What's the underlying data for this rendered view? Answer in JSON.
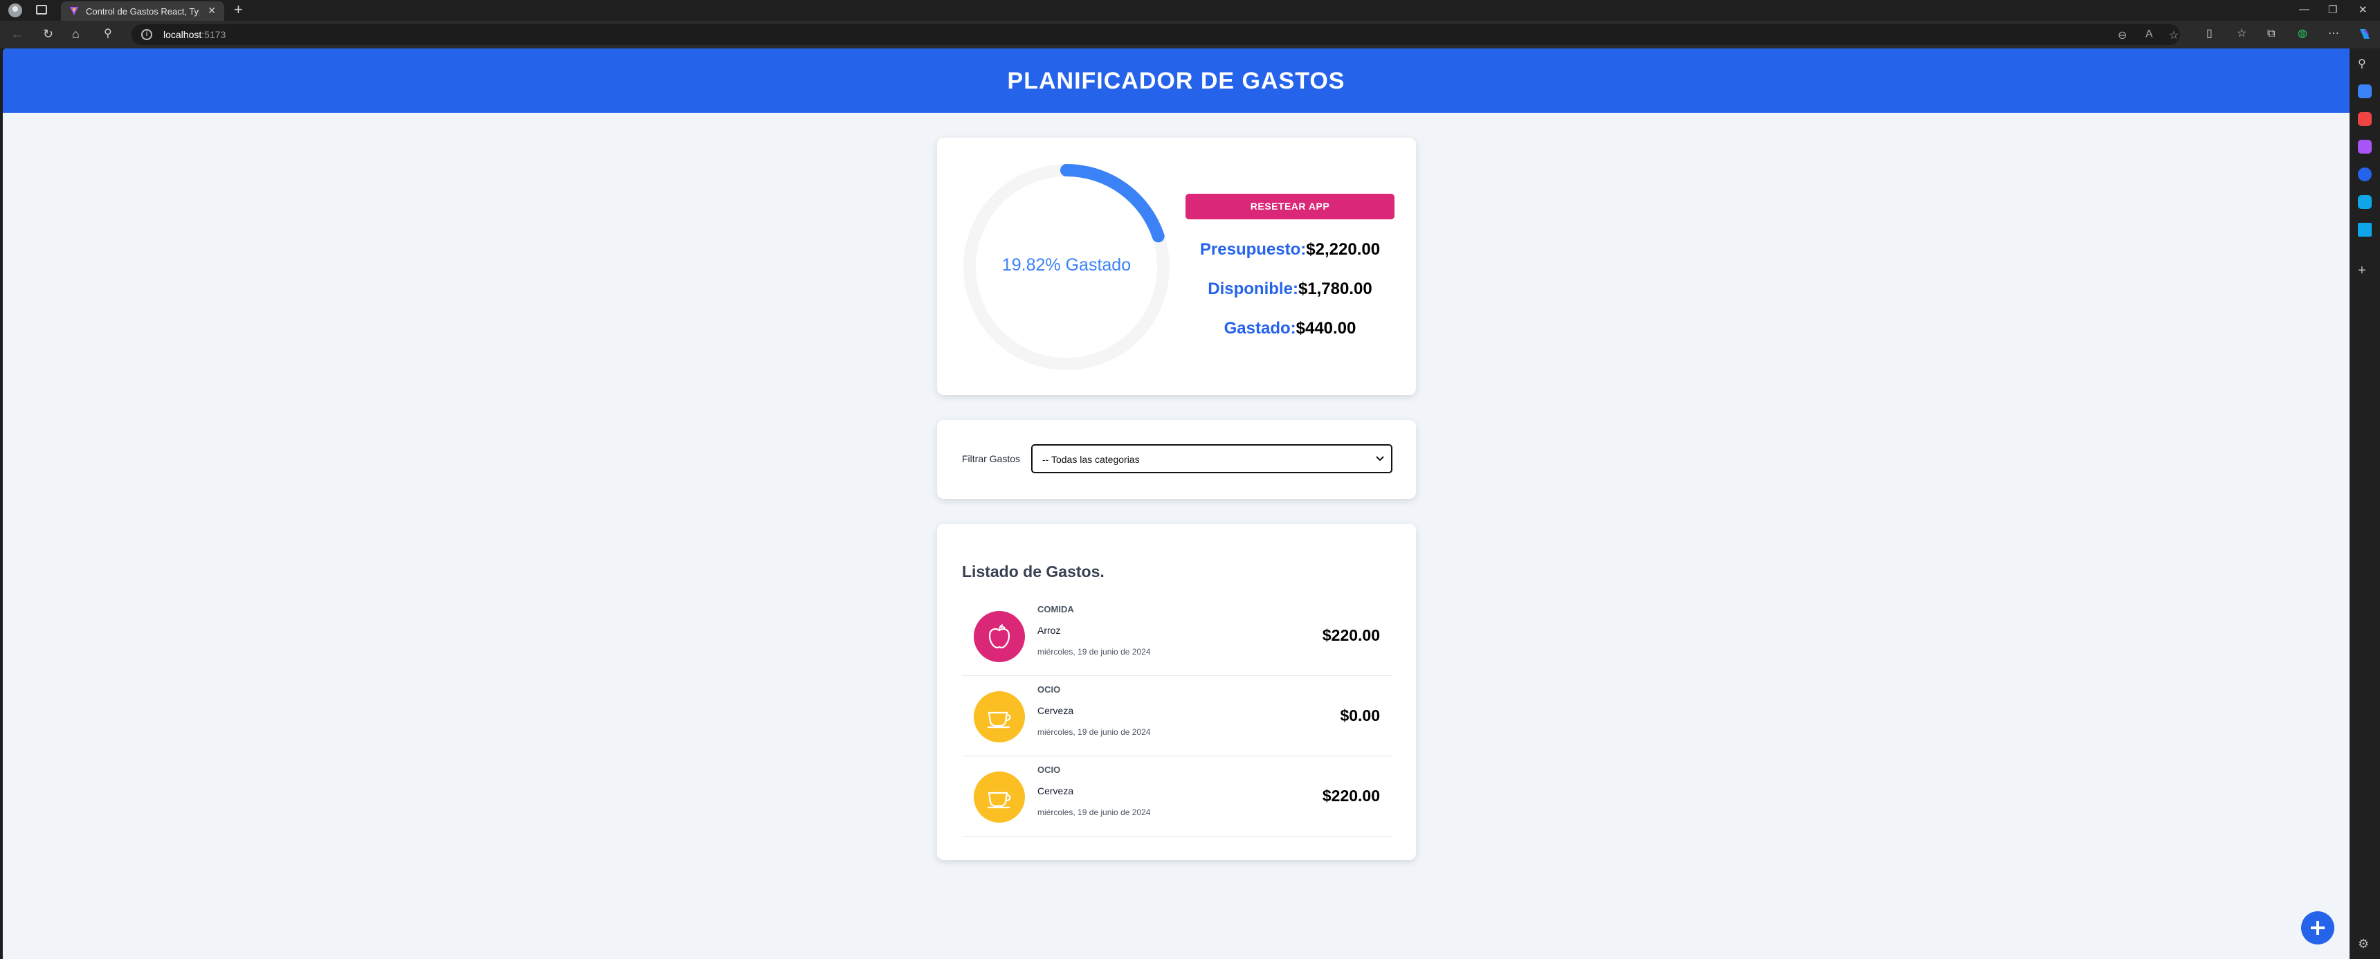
{
  "browser": {
    "tab_title": "Control de Gastos React, TypeScript",
    "tab_close": "✕",
    "new_tab": "+",
    "address_host": "localhost",
    "address_port": ":5173"
  },
  "header": {
    "title": "PLANIFICADOR DE GASTOS"
  },
  "budget": {
    "percent_label": "19.82% Gastado",
    "percent_spent": 19.82,
    "reset_label": "RESETEAR APP",
    "presupuesto_label": "Presupuesto:",
    "presupuesto_value": "$2,220.00",
    "disponible_label": "Disponible:",
    "disponible_value": "$1,780.00",
    "gastado_label": "Gastado:",
    "gastado_value": "$440.00"
  },
  "filter": {
    "label": "Filtrar Gastos",
    "selected": "-- Todas las categorias"
  },
  "expenses": {
    "title": "Listado de Gastos.",
    "items": [
      {
        "category": "COMIDA",
        "name": "Arroz",
        "date": "miércoles, 19 de junio de 2024",
        "amount": "$220.00",
        "icon": "apple-icon",
        "color": "#db2777"
      },
      {
        "category": "OCIO",
        "name": "Cerveza",
        "date": "miércoles, 19 de junio de 2024",
        "amount": "$0.00",
        "icon": "cup-icon",
        "color": "#fbbf24"
      },
      {
        "category": "OCIO",
        "name": "Cerveza",
        "date": "miércoles, 19 de junio de 2024",
        "amount": "$220.00",
        "icon": "cup-icon",
        "color": "#fbbf24"
      }
    ]
  },
  "colors": {
    "primary": "#2563eb",
    "accent": "#db2777",
    "ring_progress": "#3b82f6",
    "ring_track": "#f5f5f5",
    "background": "#f1f5f9"
  }
}
